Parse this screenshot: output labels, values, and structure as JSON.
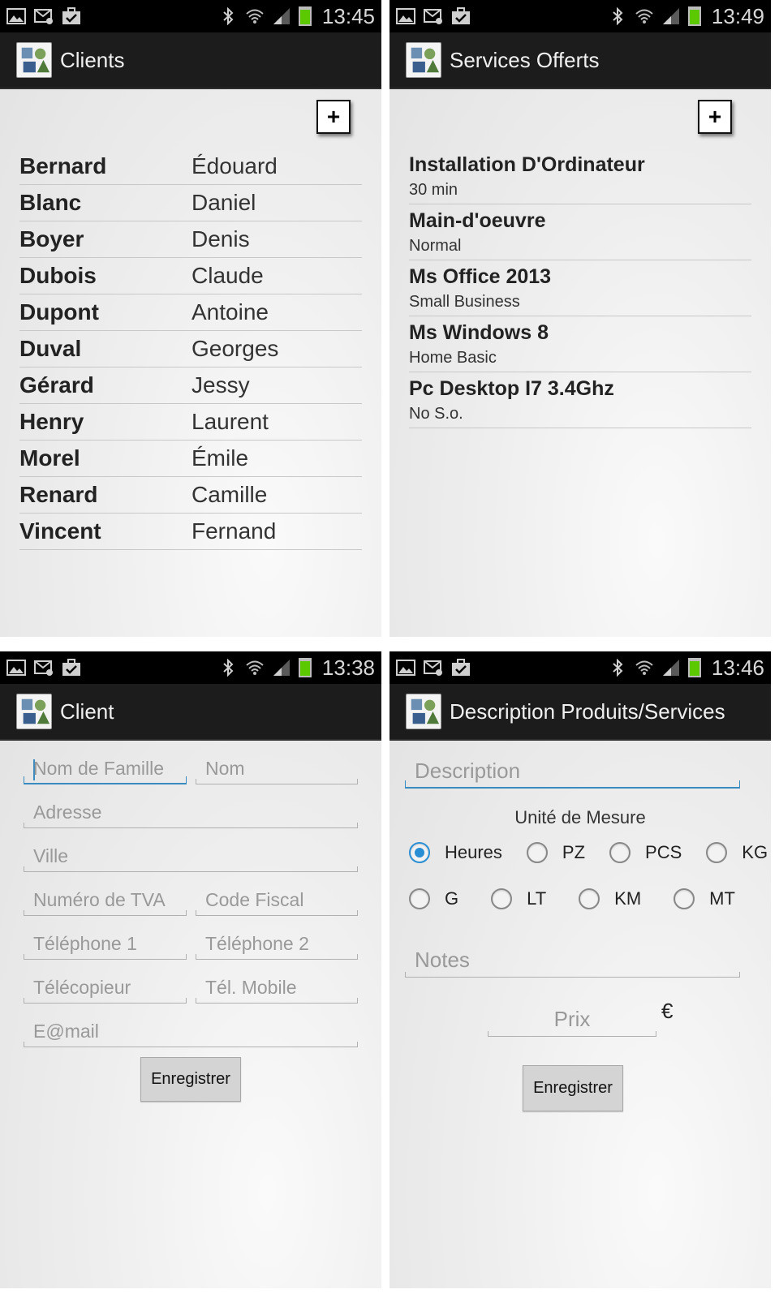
{
  "screens": {
    "clients": {
      "time": "13:45",
      "title": "Clients",
      "add_label": "+",
      "rows": [
        {
          "last": "Bernard",
          "first": "Édouard"
        },
        {
          "last": "Blanc",
          "first": "Daniel"
        },
        {
          "last": "Boyer",
          "first": "Denis"
        },
        {
          "last": "Dubois",
          "first": "Claude"
        },
        {
          "last": "Dupont",
          "first": "Antoine"
        },
        {
          "last": "Duval",
          "first": "Georges"
        },
        {
          "last": "Gérard",
          "first": "Jessy"
        },
        {
          "last": "Henry",
          "first": "Laurent"
        },
        {
          "last": "Morel",
          "first": "Émile"
        },
        {
          "last": "Renard",
          "first": "Camille"
        },
        {
          "last": "Vincent",
          "first": "Fernand"
        }
      ]
    },
    "services": {
      "time": "13:49",
      "title": "Services Offerts",
      "add_label": "+",
      "rows": [
        {
          "name": "Installation D'Ordinateur",
          "detail": "30 min"
        },
        {
          "name": "Main-d'oeuvre",
          "detail": "Normal"
        },
        {
          "name": "Ms Office 2013",
          "detail": "Small Business"
        },
        {
          "name": "Ms Windows 8",
          "detail": "Home Basic"
        },
        {
          "name": "Pc Desktop I7 3.4Ghz",
          "detail": "No S.o."
        }
      ]
    },
    "client_form": {
      "time": "13:38",
      "title": "Client",
      "placeholders": {
        "family_name": "Nom de Famille",
        "name": "Nom",
        "address": "Adresse",
        "city": "Ville",
        "vat": "Numéro de TVA",
        "fiscal_code": "Code Fiscal",
        "phone1": "Téléphone 1",
        "phone2": "Téléphone 2",
        "fax": "Télécopieur",
        "mobile": "Tél. Mobile",
        "email": "E@mail"
      },
      "save_label": "Enregistrer"
    },
    "description_form": {
      "time": "13:46",
      "title": "Description Produits/Services",
      "description_placeholder": "Description",
      "unit_label": "Unité de Mesure",
      "units": [
        "Heures",
        "PZ",
        "PCS",
        "KG",
        "G",
        "LT",
        "KM",
        "MT"
      ],
      "selected_unit": "Heures",
      "notes_placeholder": "Notes",
      "price_placeholder": "Prix",
      "currency": "€",
      "save_label": "Enregistrer"
    }
  },
  "colors": {
    "status_bar": "#000000",
    "action_bar": "#1c1c1c",
    "accent": "#2a8ed4",
    "battery": "#5cc800"
  },
  "icons": [
    "image-icon",
    "mail-icon",
    "briefcase-check-icon",
    "bluetooth-icon",
    "wifi-icon",
    "signal-icon",
    "battery-icon",
    "app-logo-icon",
    "add-icon"
  ]
}
